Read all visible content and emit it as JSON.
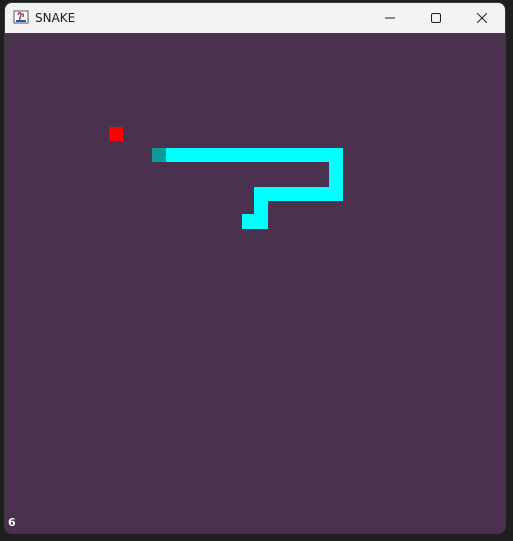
{
  "window": {
    "title": "SNAKE",
    "icon": "java-app-icon",
    "controls": [
      "minimize-icon",
      "maximize-icon",
      "close-icon"
    ]
  },
  "game": {
    "score": "6",
    "colors": {
      "background": "#4a324e",
      "food": "#ff0000",
      "snake_body": "#00ffff",
      "snake_head": "#0e9a9a"
    }
  }
}
